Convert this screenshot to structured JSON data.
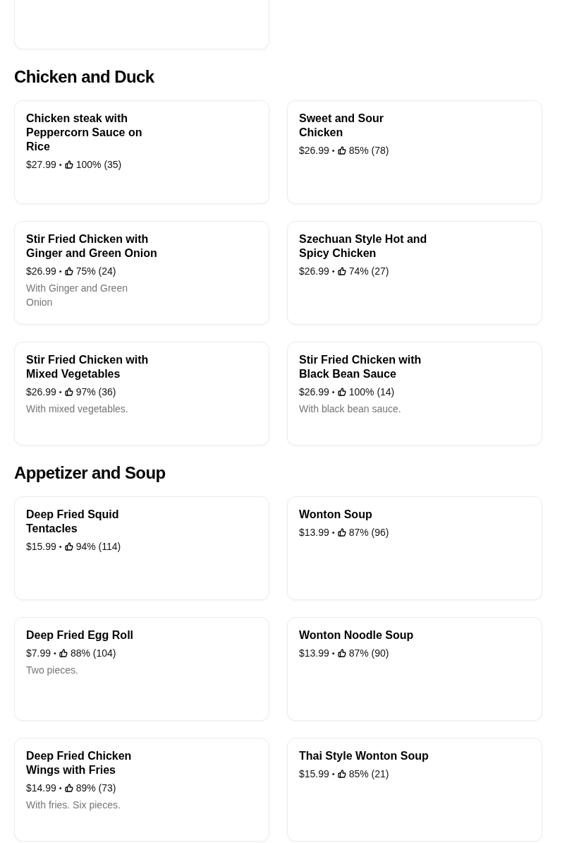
{
  "sections": [
    {
      "title": "Chicken and Duck",
      "items": [
        {
          "name": "Chicken steak with Peppercorn Sauce on Rice",
          "price": "$27.99",
          "separator": "•",
          "rating": "100% (35)"
        },
        {
          "name": "Sweet and Sour Chicken",
          "price": "$26.99",
          "separator": "•",
          "rating": "85% (78)"
        },
        {
          "name": "Stir Fried Chicken with Ginger and Green Onion",
          "price": "$26.99",
          "separator": "•",
          "rating": "75% (24)",
          "description": "With Ginger and Green Onion"
        },
        {
          "name": "Szechuan Style Hot and Spicy Chicken",
          "price": "$26.99",
          "separator": "•",
          "rating": "74% (27)"
        },
        {
          "name": "Stir Fried Chicken with Mixed Vegetables",
          "price": "$26.99",
          "separator": "•",
          "rating": "97% (36)",
          "description": "With mixed vegetables."
        },
        {
          "name": "Stir Fried Chicken with Black Bean Sauce",
          "price": "$26.99",
          "separator": "•",
          "rating": "100% (14)",
          "description": "With black bean sauce."
        }
      ]
    },
    {
      "title": "Appetizer and Soup",
      "items": [
        {
          "name": "Deep Fried Squid Tentacles",
          "price": "$15.99",
          "separator": "•",
          "rating": "94% (114)"
        },
        {
          "name": "Wonton Soup",
          "price": "$13.99",
          "separator": "•",
          "rating": "87% (96)"
        },
        {
          "name": "Deep Fried Egg Roll",
          "price": "$7.99",
          "separator": "•",
          "rating": "88% (104)",
          "description": "Two pieces."
        },
        {
          "name": "Wonton Noodle Soup",
          "price": "$13.99",
          "separator": "•",
          "rating": "87% (90)"
        },
        {
          "name": "Deep Fried Chicken Wings with Fries",
          "price": "$14.99",
          "separator": "•",
          "rating": "89% (73)",
          "description": "With fries. Six pieces."
        },
        {
          "name": "Thai Style Wonton Soup",
          "price": "$15.99",
          "separator": "•",
          "rating": "85% (21)"
        }
      ]
    }
  ]
}
